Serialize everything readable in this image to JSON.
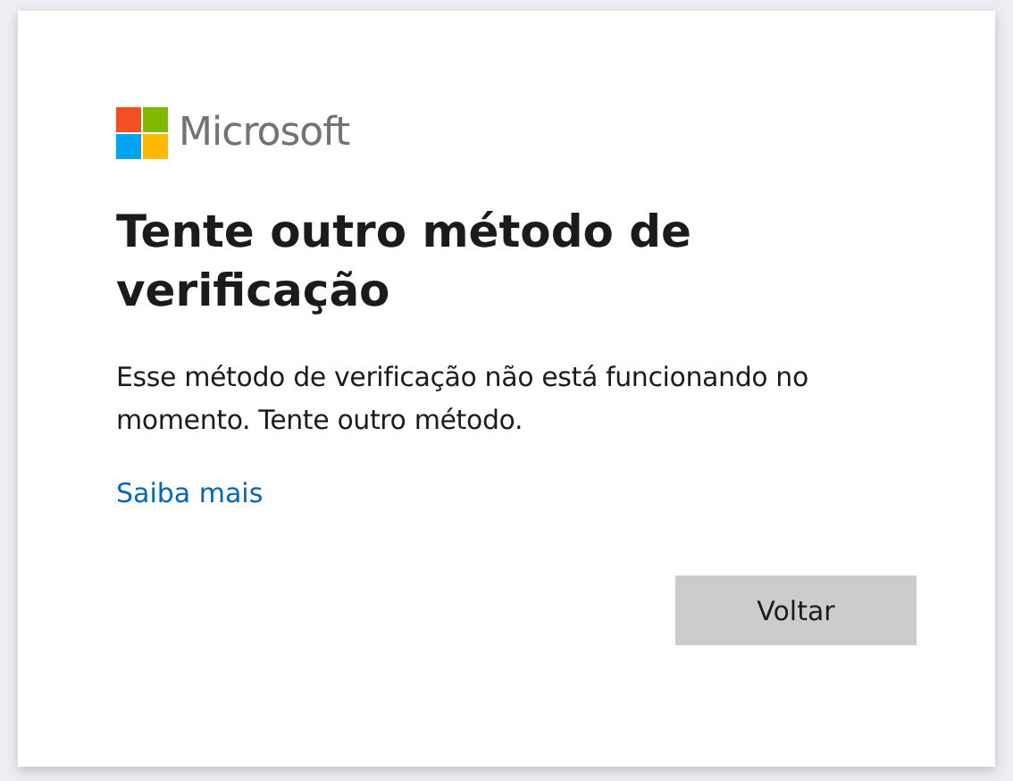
{
  "logo": {
    "text": "Microsoft"
  },
  "title": "Tente outro método de verificação",
  "description": "Esse método de verificação não está funcionando no momento. Tente outro método.",
  "link": "Saiba mais",
  "buttons": [
    "Voltar"
  ]
}
